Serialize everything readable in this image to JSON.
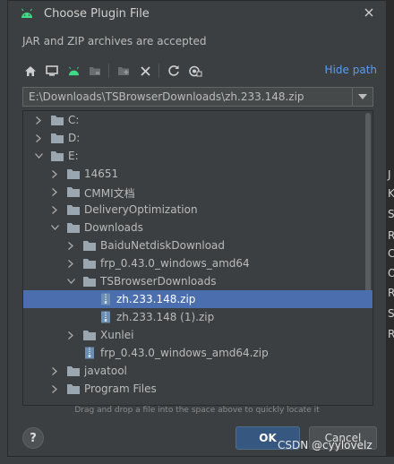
{
  "dialog": {
    "title": "Choose Plugin File",
    "description": "JAR and ZIP archives are accepted",
    "hide_path_label": "Hide path",
    "path_value": "E:\\Downloads\\TSBrowserDownloads\\zh.233.148.zip",
    "drag_hint": "Drag and drop a file into the space above to quickly locate it",
    "ok_label": "OK",
    "cancel_label": "Cancel",
    "help_label": "?"
  },
  "toolbar": {
    "icons": [
      "home-icon",
      "desktop-icon",
      "android-icon",
      "module-icon",
      "new-folder-icon",
      "delete-icon",
      "refresh-icon",
      "show-hidden-icon"
    ]
  },
  "tree": {
    "rows": [
      {
        "label": "C:",
        "expanded": false,
        "type": "folder",
        "selected": false
      },
      {
        "label": "D:",
        "expanded": false,
        "type": "folder",
        "selected": false
      },
      {
        "label": "E:",
        "expanded": true,
        "type": "folder",
        "selected": false
      },
      {
        "label": "14651",
        "expanded": false,
        "type": "folder",
        "selected": false
      },
      {
        "label": "CMMI文档",
        "expanded": false,
        "type": "folder",
        "selected": false
      },
      {
        "label": "DeliveryOptimization",
        "expanded": false,
        "type": "folder",
        "selected": false
      },
      {
        "label": "Downloads",
        "expanded": true,
        "type": "folder",
        "selected": false
      },
      {
        "label": "BaiduNetdiskDownload",
        "expanded": false,
        "type": "folder",
        "selected": false
      },
      {
        "label": "frp_0.43.0_windows_amd64",
        "expanded": false,
        "type": "folder",
        "selected": false
      },
      {
        "label": "TSBrowserDownloads",
        "expanded": true,
        "type": "folder",
        "selected": false
      },
      {
        "label": "zh.233.148.zip",
        "expanded": false,
        "type": "zip",
        "selected": true
      },
      {
        "label": "zh.233.148 (1).zip",
        "expanded": false,
        "type": "zip",
        "selected": false
      },
      {
        "label": "Xunlei",
        "expanded": false,
        "type": "folder",
        "selected": false
      },
      {
        "label": "frp_0.43.0_windows_amd64.zip",
        "expanded": false,
        "type": "zip",
        "selected": false
      },
      {
        "label": "javatool",
        "expanded": false,
        "type": "folder",
        "selected": false
      },
      {
        "label": "Program Files",
        "expanded": false,
        "type": "folder",
        "selected": false
      }
    ]
  },
  "background": {
    "left_chars": [
      "ic"
    ],
    "right_chars": [
      "B",
      "J",
      "K",
      "S",
      "R",
      "C",
      "O",
      "R",
      "S",
      "R"
    ]
  },
  "watermark": "CSDN @cyylovelz",
  "colors": {
    "accent": "#589df6",
    "selection": "#4b6eaf",
    "android": "#3ddc84",
    "ok_button": "#365880"
  }
}
